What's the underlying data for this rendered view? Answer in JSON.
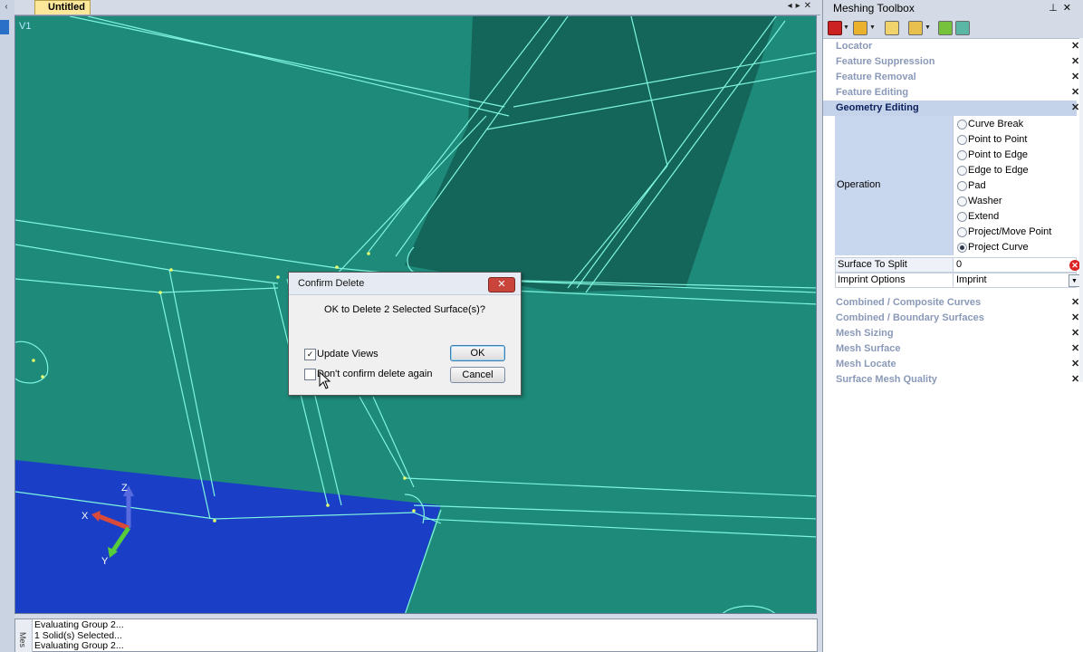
{
  "document": {
    "tab_title": "Untitled",
    "view_label": "V1"
  },
  "axes": {
    "x": "X",
    "y": "Y",
    "z": "Z"
  },
  "dialog": {
    "title": "Confirm Delete",
    "close": "✕",
    "message": "OK to Delete 2 Selected Surface(s)?",
    "update_views": {
      "label": "Update Views",
      "checked": true
    },
    "dont_confirm": {
      "label": "Don't confirm delete again",
      "checked": false
    },
    "ok_label": "OK",
    "cancel_label": "Cancel"
  },
  "output": {
    "tab_label": "Mes",
    "lines": [
      "Evaluating Group 2...",
      "1 Solid(s) Selected...",
      "Evaluating Group 2..."
    ]
  },
  "toolbox": {
    "title": "Meshing Toolbox",
    "sections_top": [
      "Locator",
      "Feature Suppression",
      "Feature Removal",
      "Feature Editing"
    ],
    "active_section": "Geometry Editing",
    "operation_label": "Operation",
    "operations": [
      "Curve Break",
      "Point to Point",
      "Point to Edge",
      "Edge to Edge",
      "Pad",
      "Washer",
      "Extend",
      "Project/Move Point",
      "Project Curve"
    ],
    "selected_operation": "Project Curve",
    "properties": [
      {
        "key": "Surface To Split",
        "value": "0"
      },
      {
        "key": "Imprint Options",
        "value": "Imprint"
      }
    ],
    "sections_bottom": [
      "Combined / Composite Curves",
      "Combined / Boundary Surfaces",
      "Mesh Sizing",
      "Mesh Surface",
      "Mesh Locate",
      "Surface Mesh Quality"
    ]
  },
  "colors": {
    "viewport_bg": "#1e8a7a",
    "edge": "#7ff5e0",
    "selected_surface": "#1a3fc6",
    "dark_face": "#14665a"
  }
}
